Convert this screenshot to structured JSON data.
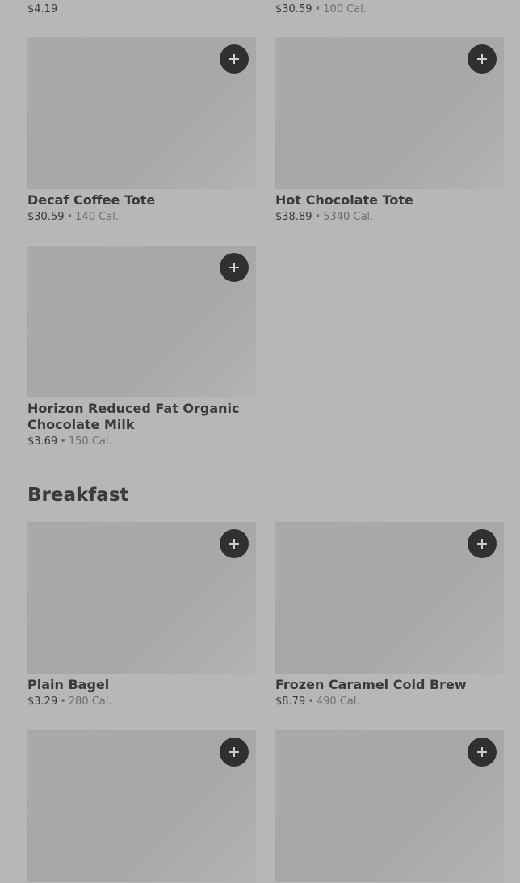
{
  "top_partial": {
    "left_price": "$4.19",
    "right_price": "$30.59",
    "right_cal": "100 Cal."
  },
  "beverages": [
    {
      "name": "Decaf Coffee Tote",
      "price": "$30.59",
      "cal": "140 Cal."
    },
    {
      "name": "Hot Chocolate Tote",
      "price": "$38.89",
      "cal": "5340 Cal."
    },
    {
      "name": "Horizon Reduced Fat Organic Chocolate Milk",
      "price": "$3.69",
      "cal": "150 Cal."
    }
  ],
  "breakfast": {
    "title": "Breakfast",
    "items": [
      {
        "name": "Plain Bagel",
        "price": "$3.29",
        "cal": "280 Cal."
      },
      {
        "name": "Frozen Caramel Cold Brew",
        "price": "$8.79",
        "cal": "490 Cal."
      }
    ]
  },
  "separator": "•",
  "icons": {
    "add": "plus-icon"
  }
}
